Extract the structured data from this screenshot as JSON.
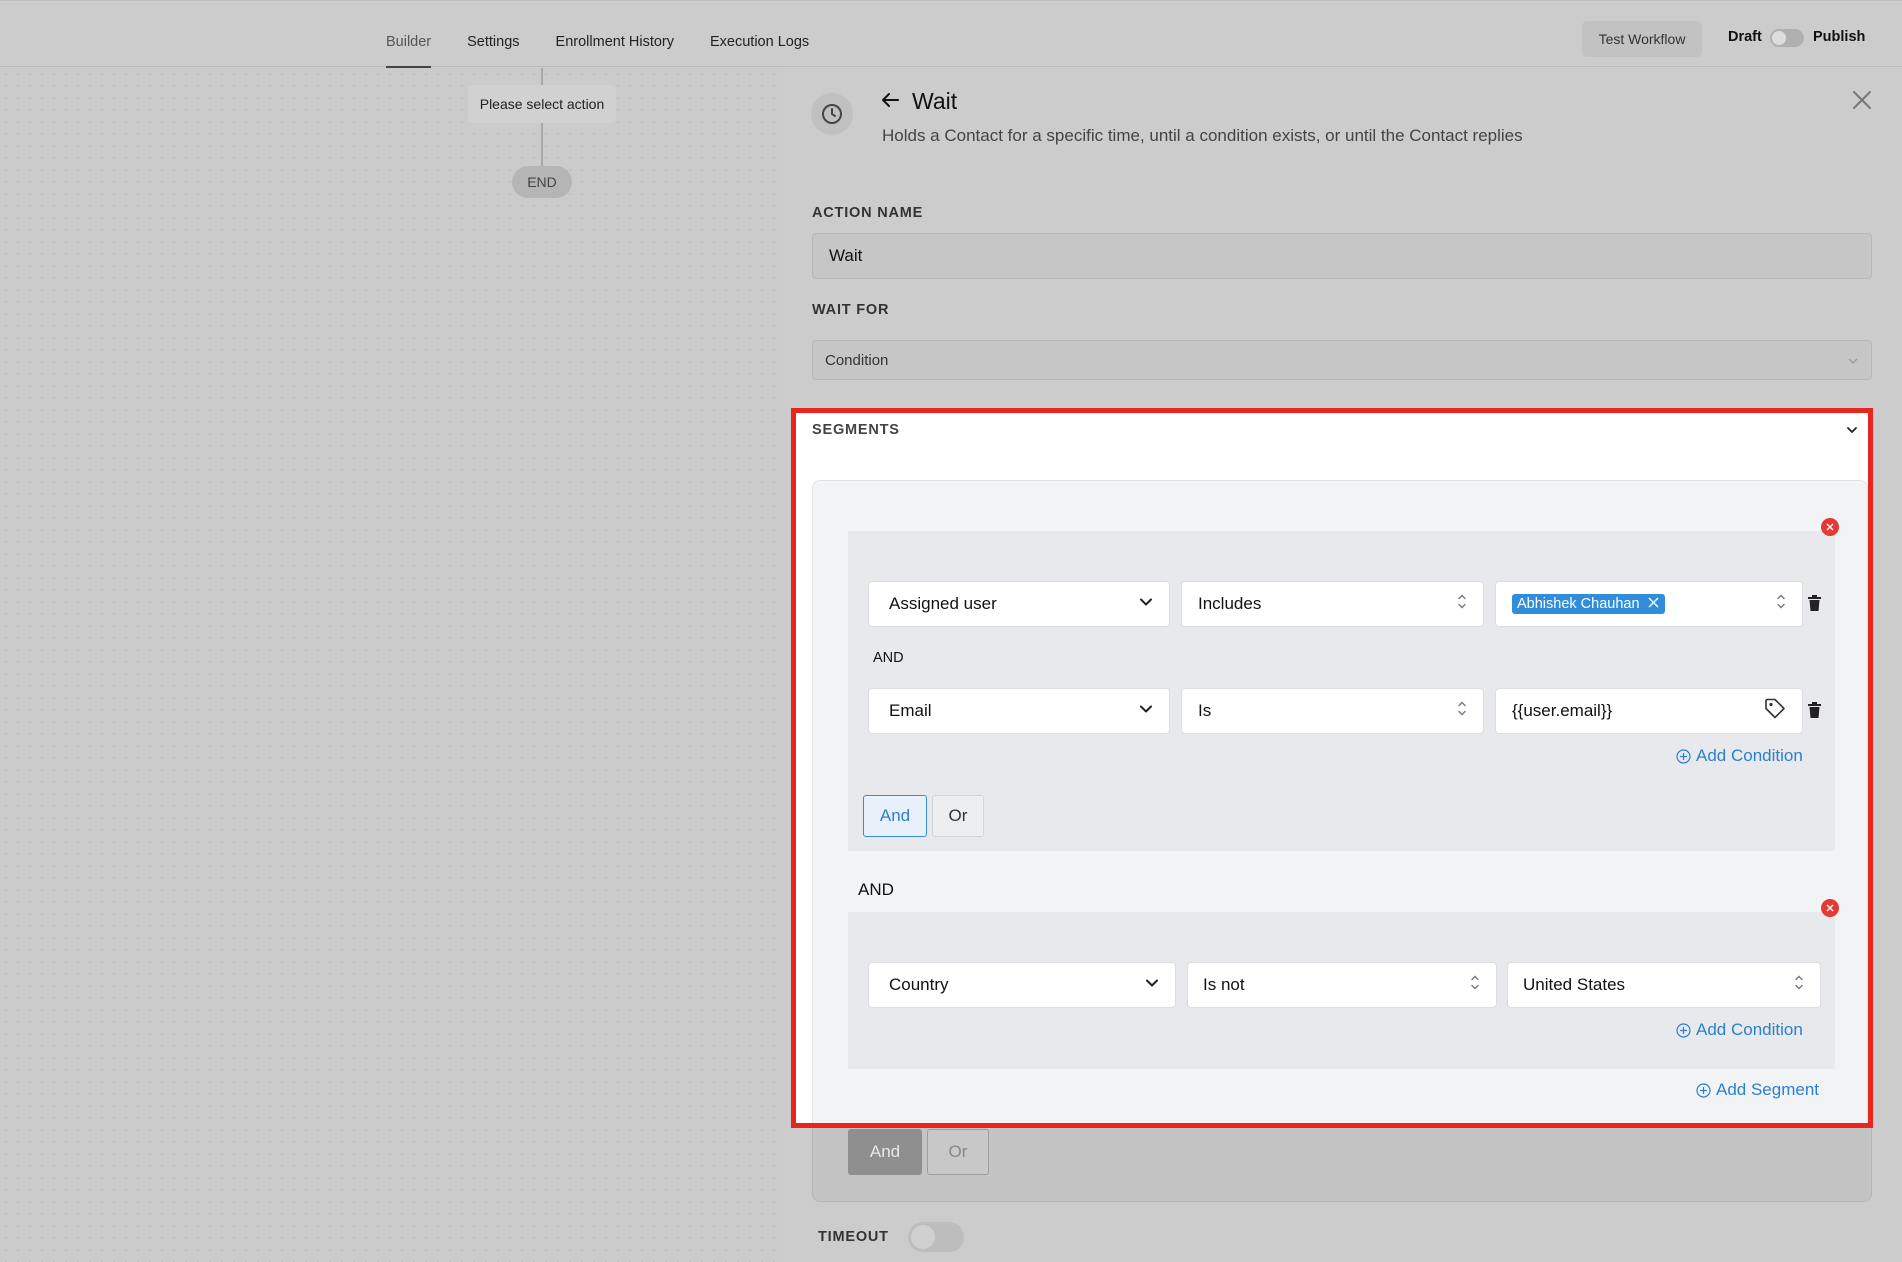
{
  "nav": {
    "tabs": [
      {
        "label": "Builder",
        "active": true
      },
      {
        "label": "Settings"
      },
      {
        "label": "Enrollment History"
      },
      {
        "label": "Execution Logs"
      }
    ],
    "test_workflow": "Test Workflow",
    "draft": "Draft",
    "publish": "Publish",
    "publish_toggle_on": false
  },
  "canvas": {
    "action_node": "Please select action",
    "end_node": "END"
  },
  "panel": {
    "icon": "clock-icon",
    "title": "Wait",
    "description": "Holds a Contact for a specific time, until a condition exists, or until the Contact replies",
    "action_name_label": "ACTION NAME",
    "action_name_value": "Wait",
    "wait_for_label": "WAIT FOR",
    "wait_for_value": "Condition",
    "segments_label": "SEGMENTS",
    "timeout_label": "TIMEOUT",
    "timeout_on": false
  },
  "segments": [
    {
      "conditions": [
        {
          "field": "Assigned user",
          "operator": "Includes",
          "value_chip": "Abhishek Chauhan"
        },
        {
          "field": "Email",
          "operator": "Is",
          "value": "{{user.email}}"
        }
      ],
      "joiner": "AND",
      "add_condition": "Add Condition",
      "logic_and": "And",
      "logic_or": "Or"
    },
    {
      "conditions": [
        {
          "field": "Country",
          "operator": "Is not",
          "value": "United States"
        }
      ],
      "add_condition": "Add Condition"
    }
  ],
  "segment_joiner": "AND",
  "add_segment": "Add Segment",
  "bottom_and": "And",
  "bottom_or": "Or",
  "colors": {
    "accent": "#2b7fd0",
    "highlight": "#e8261e",
    "remove": "#e53935"
  }
}
